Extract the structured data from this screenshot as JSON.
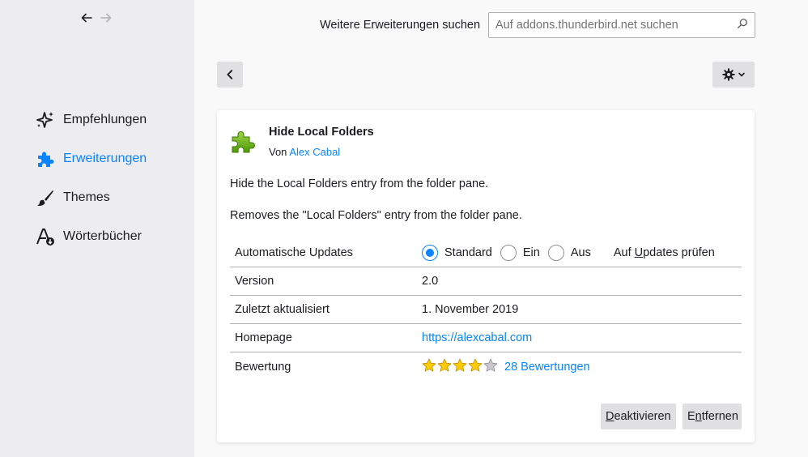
{
  "sidebar": {
    "categories": [
      {
        "label": "Empfehlungen",
        "icon": "sparkle-icon"
      },
      {
        "label": "Erweiterungen",
        "icon": "puzzle-icon",
        "selected": true
      },
      {
        "label": "Themes",
        "icon": "brush-icon"
      },
      {
        "label": "Wörterbücher",
        "icon": "dictionary-icon"
      }
    ]
  },
  "header": {
    "search_label": "Weitere Erweiterungen suchen",
    "search_placeholder": "Auf addons.thunderbird.net suchen"
  },
  "addon": {
    "name": "Hide Local Folders",
    "author_prefix": "Von",
    "author": "Alex Cabal",
    "description": "Hide the Local Folders entry from the folder pane.",
    "full_description": "Removes the \"Local Folders\" entry from the folder pane.",
    "details": {
      "updates_label": "Automatische Updates",
      "updates_options": [
        "Standard",
        "Ein",
        "Aus"
      ],
      "updates_selected": "Standard",
      "check_updates_pre": "Auf ",
      "check_updates_accel": "U",
      "check_updates_post": "pdates prüfen",
      "version_label": "Version",
      "version": "2.0",
      "updated_label": "Zuletzt aktualisiert",
      "updated": "1. November 2019",
      "homepage_label": "Homepage",
      "homepage": "https://alexcabal.com",
      "rating_label": "Bewertung",
      "rating_value": 4,
      "rating_max": 5,
      "reviews": "28 Bewertungen"
    },
    "buttons": {
      "disable_accel": "D",
      "disable_rest": "eaktivieren",
      "remove_pre": "E",
      "remove_accel": "n",
      "remove_rest": "tfernen"
    }
  },
  "colors": {
    "accent": "#0a84ff",
    "star": "#ffcb00",
    "sidebar_bg": "#ededf0"
  }
}
